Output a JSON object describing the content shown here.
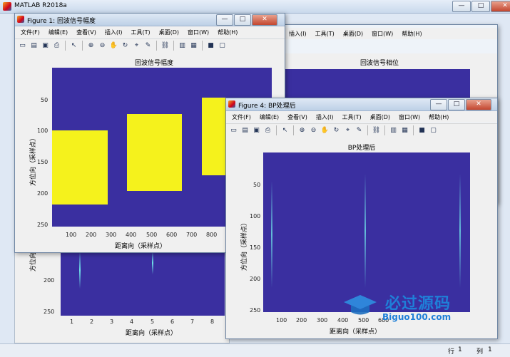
{
  "main_window": {
    "title": "MATLAB R2018a",
    "status_row_label": "行",
    "status_row_value": "1",
    "status_col_label": "列",
    "status_col_value": "1"
  },
  "sysbuttons": {
    "minimize": "—",
    "maximize": "□",
    "close": "✕"
  },
  "menu": [
    "文件(F)",
    "编辑(E)",
    "查看(V)",
    "插入(I)",
    "工具(T)",
    "桌面(D)",
    "窗口(W)",
    "帮助(H)"
  ],
  "fig1": {
    "title": "Figure 1: 回波信号幅度",
    "axes_title": "回波信号幅度",
    "ylabel": "方位向（采样点）",
    "xlabel": "距离向（采样点）",
    "yticks": [
      "50",
      "100",
      "150",
      "200",
      "250"
    ],
    "xticks": [
      "100",
      "200",
      "300",
      "400",
      "500",
      "600",
      "700",
      "800"
    ]
  },
  "fig2": {
    "axes_title": "回波信号相位",
    "ylabel": "方位向（采样点）",
    "xlabel": "距离向（采样点）",
    "yticks": [
      "200",
      "250"
    ],
    "xticks": [
      "1",
      "2",
      "3",
      "4",
      "5",
      "6",
      "7",
      "8"
    ]
  },
  "fig4": {
    "title": "Figure 4: BP处理后",
    "axes_title": "BP处理后",
    "ylabel": "方位向（采样点）",
    "xlabel": "距离向（采样点）",
    "yticks": [
      "50",
      "100",
      "150",
      "200",
      "250"
    ],
    "xticks": [
      "100",
      "200",
      "300",
      "400",
      "500",
      "600"
    ]
  },
  "watermark": {
    "text1": "必过源码",
    "text2": "Biguo100.com"
  },
  "colors": {
    "plot_bg": "#3a2fa0",
    "yellow": "#f5f21c",
    "streak": "#6ee0e8"
  }
}
